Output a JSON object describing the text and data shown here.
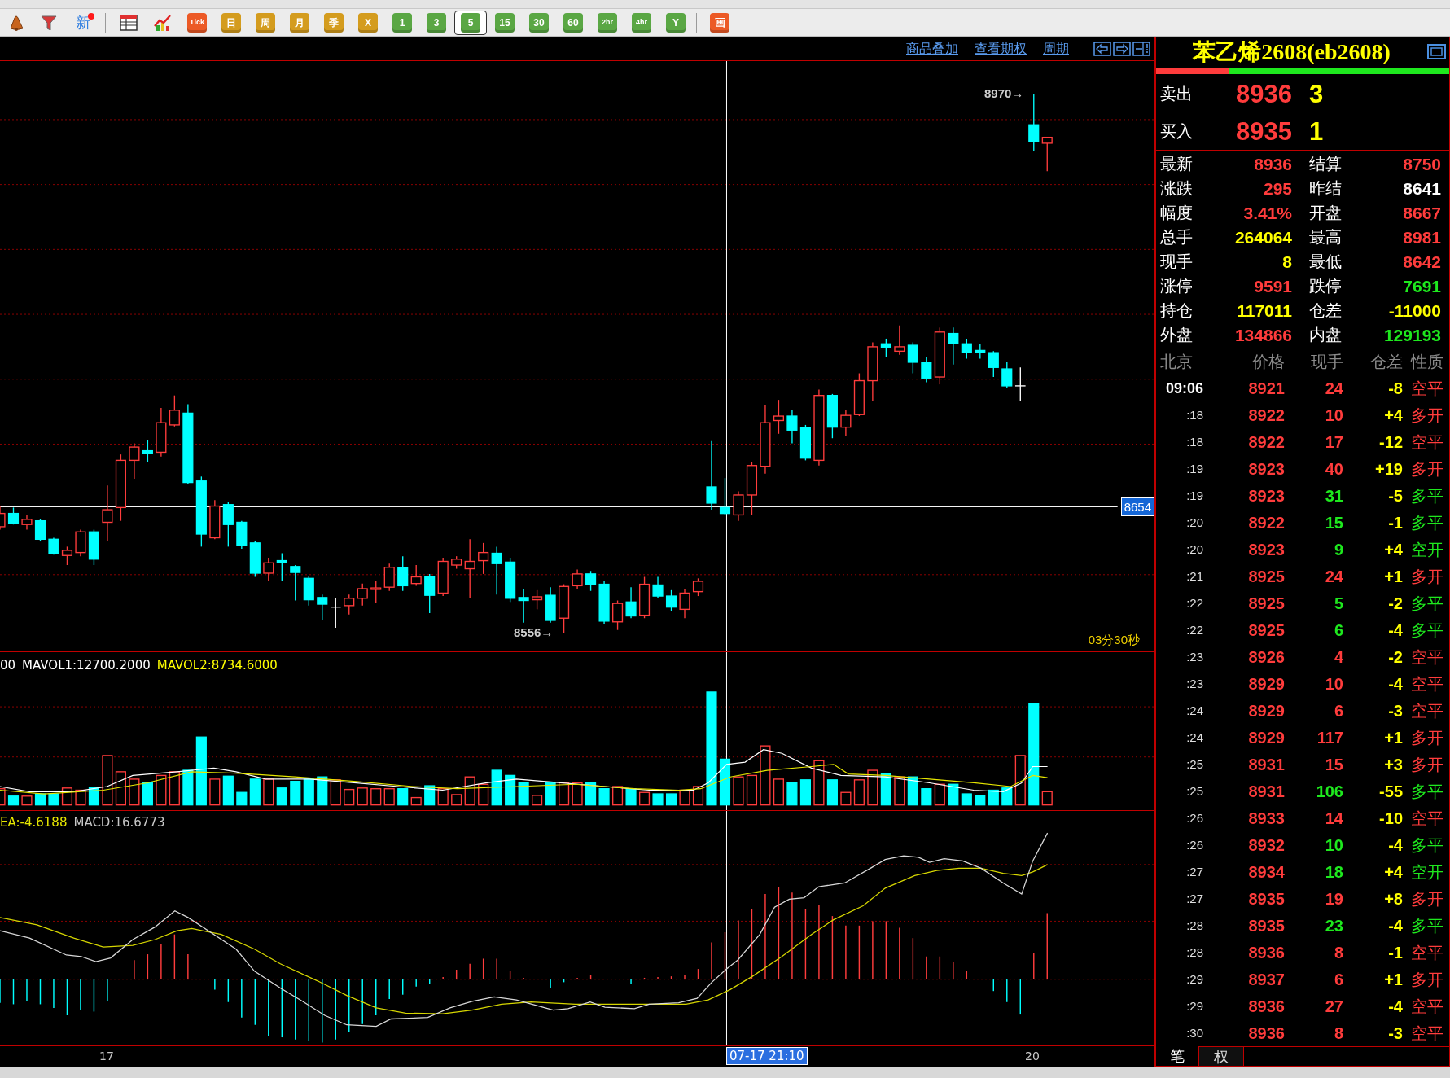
{
  "toolbar": {
    "new_button": {
      "label": "新",
      "unread": true
    },
    "periods": [
      {
        "label": "Tick",
        "kind": "tick",
        "selected": false
      },
      {
        "label": "日",
        "kind": "calendar",
        "selected": false
      },
      {
        "label": "周",
        "kind": "calendar",
        "selected": false
      },
      {
        "label": "月",
        "kind": "calendar",
        "selected": false
      },
      {
        "label": "季",
        "kind": "calendar",
        "selected": false
      },
      {
        "label": "X",
        "kind": "calendar",
        "selected": false
      },
      {
        "label": "1",
        "kind": "timeframe",
        "selected": false
      },
      {
        "label": "3",
        "kind": "timeframe",
        "selected": false
      },
      {
        "label": "5",
        "kind": "timeframe",
        "selected": true
      },
      {
        "label": "15",
        "kind": "timeframe",
        "selected": false
      },
      {
        "label": "30",
        "kind": "timeframe",
        "selected": false
      },
      {
        "label": "60",
        "kind": "timeframe",
        "selected": false
      },
      {
        "label": "2hr",
        "kind": "timeframe",
        "selected": false
      },
      {
        "label": "4hr",
        "kind": "timeframe",
        "selected": false
      },
      {
        "label": "Y",
        "kind": "timeframe",
        "selected": false
      }
    ],
    "draw_button": "画"
  },
  "chart_header": {
    "links": [
      "商品叠加",
      "查看期权",
      "周期"
    ]
  },
  "price_pane": {
    "high_marker": "8970→",
    "low_marker": "8556→",
    "crosshair_price": "8654",
    "countdown": "03分30秒"
  },
  "volume_pane": {
    "labels": [
      {
        "text": "00",
        "color": "#ffffff"
      },
      {
        "text": "MAVOL1:12700.2000",
        "color": "#ffffff"
      },
      {
        "text": "MAVOL2:8734.6000",
        "color": "#ffff00"
      }
    ]
  },
  "macd_pane": {
    "labels": [
      {
        "text": "EA:-4.6188",
        "color": "#e6e600"
      },
      {
        "text": "MACD:16.6773",
        "color": "#c8c8c8"
      }
    ]
  },
  "x_axis": {
    "ticks": [
      "17",
      "20"
    ],
    "crosshair_time": "07-17 21:10"
  },
  "quote": {
    "title": "苯乙烯2608(eb2608)",
    "flow_bar": {
      "level": 0.25
    },
    "ask": {
      "label": "卖出",
      "price": "8936",
      "volume": "3"
    },
    "bid": {
      "label": "买入",
      "price": "8935",
      "volume": "1"
    },
    "stats": [
      {
        "label": "最新",
        "value": "8936",
        "color": "#ff3c3c"
      },
      {
        "label": "结算",
        "value": "8750",
        "color": "#ff3c3c"
      },
      {
        "label": "涨跌",
        "value": "295",
        "color": "#ff3c3c"
      },
      {
        "label": "昨结",
        "value": "8641",
        "color": "#ffffff"
      },
      {
        "label": "幅度",
        "value": "3.41%",
        "color": "#ff3c3c"
      },
      {
        "label": "开盘",
        "value": "8667",
        "color": "#ff3c3c"
      },
      {
        "label": "总手",
        "value": "264064",
        "color": "#ffff00"
      },
      {
        "label": "最高",
        "value": "8981",
        "color": "#ff3c3c"
      },
      {
        "label": "现手",
        "value": "8",
        "color": "#ffff00"
      },
      {
        "label": "最低",
        "value": "8642",
        "color": "#ff3c3c"
      },
      {
        "label": "涨停",
        "value": "9591",
        "color": "#ff3c3c"
      },
      {
        "label": "跌停",
        "value": "7691",
        "color": "#1ee81e"
      },
      {
        "label": "持仓",
        "value": "117011",
        "color": "#ffff00"
      },
      {
        "label": "仓差",
        "value": "-11000",
        "color": "#ffff00"
      },
      {
        "label": "外盘",
        "value": "134866",
        "color": "#ff3c3c"
      },
      {
        "label": "内盘",
        "value": "129193",
        "color": "#1ee81e"
      }
    ]
  },
  "trades": {
    "columns": [
      "北京",
      "价格",
      "现手",
      "仓差",
      "性质"
    ],
    "rows": [
      {
        "time": "09:06",
        "price": "8921",
        "volume": "24",
        "change": "-8",
        "nature": "空平",
        "color": "#ff3c3c"
      },
      {
        "time": ":18",
        "price": "8922",
        "volume": "10",
        "change": "+4",
        "nature": "多开",
        "color": "#ff3c3c"
      },
      {
        "time": ":18",
        "price": "8922",
        "volume": "17",
        "change": "-12",
        "nature": "空平",
        "color": "#ff3c3c"
      },
      {
        "time": ":19",
        "price": "8923",
        "volume": "40",
        "change": "+19",
        "nature": "多开",
        "color": "#ff3c3c"
      },
      {
        "time": ":19",
        "price": "8923",
        "volume": "31",
        "change": "-5",
        "nature": "多平",
        "color": "#1ee81e"
      },
      {
        "time": ":20",
        "price": "8922",
        "volume": "15",
        "change": "-1",
        "nature": "多平",
        "color": "#1ee81e"
      },
      {
        "time": ":20",
        "price": "8923",
        "volume": "9",
        "change": "+4",
        "nature": "空开",
        "color": "#1ee81e"
      },
      {
        "time": ":21",
        "price": "8925",
        "volume": "24",
        "change": "+1",
        "nature": "多开",
        "color": "#ff3c3c"
      },
      {
        "time": ":22",
        "price": "8925",
        "volume": "5",
        "change": "-2",
        "nature": "多平",
        "color": "#1ee81e"
      },
      {
        "time": ":22",
        "price": "8925",
        "volume": "6",
        "change": "-4",
        "nature": "多平",
        "color": "#1ee81e"
      },
      {
        "time": ":23",
        "price": "8926",
        "volume": "4",
        "change": "-2",
        "nature": "空平",
        "color": "#ff3c3c"
      },
      {
        "time": ":23",
        "price": "8929",
        "volume": "10",
        "change": "-4",
        "nature": "空平",
        "color": "#ff3c3c"
      },
      {
        "time": ":24",
        "price": "8929",
        "volume": "6",
        "change": "-3",
        "nature": "空平",
        "color": "#ff3c3c"
      },
      {
        "time": ":24",
        "price": "8929",
        "volume": "117",
        "change": "+1",
        "nature": "多开",
        "color": "#ff3c3c"
      },
      {
        "time": ":25",
        "price": "8931",
        "volume": "15",
        "change": "+3",
        "nature": "多开",
        "color": "#ff3c3c"
      },
      {
        "time": ":25",
        "price": "8931",
        "volume": "106",
        "change": "-55",
        "nature": "多平",
        "color": "#1ee81e"
      },
      {
        "time": ":26",
        "price": "8933",
        "volume": "14",
        "change": "-10",
        "nature": "空平",
        "color": "#ff3c3c"
      },
      {
        "time": ":26",
        "price": "8932",
        "volume": "10",
        "change": "-4",
        "nature": "多平",
        "color": "#1ee81e"
      },
      {
        "time": ":27",
        "price": "8934",
        "volume": "18",
        "change": "+4",
        "nature": "空开",
        "color": "#1ee81e"
      },
      {
        "time": ":27",
        "price": "8935",
        "volume": "19",
        "change": "+8",
        "nature": "多开",
        "color": "#ff3c3c"
      },
      {
        "time": ":28",
        "price": "8935",
        "volume": "23",
        "change": "-4",
        "nature": "多平",
        "color": "#1ee81e"
      },
      {
        "time": ":28",
        "price": "8936",
        "volume": "8",
        "change": "-1",
        "nature": "空平",
        "color": "#ff3c3c"
      },
      {
        "time": ":29",
        "price": "8937",
        "volume": "6",
        "change": "+1",
        "nature": "多开",
        "color": "#ff3c3c"
      },
      {
        "time": ":29",
        "price": "8936",
        "volume": "27",
        "change": "-4",
        "nature": "空平",
        "color": "#ff3c3c"
      },
      {
        "time": ":30",
        "price": "8936",
        "volume": "8",
        "change": "-3",
        "nature": "空平",
        "color": "#ff3c3c"
      }
    ]
  },
  "bottom_tabs": [
    {
      "label": "笔",
      "selected": true
    },
    {
      "label": "权",
      "selected": false
    }
  ]
}
